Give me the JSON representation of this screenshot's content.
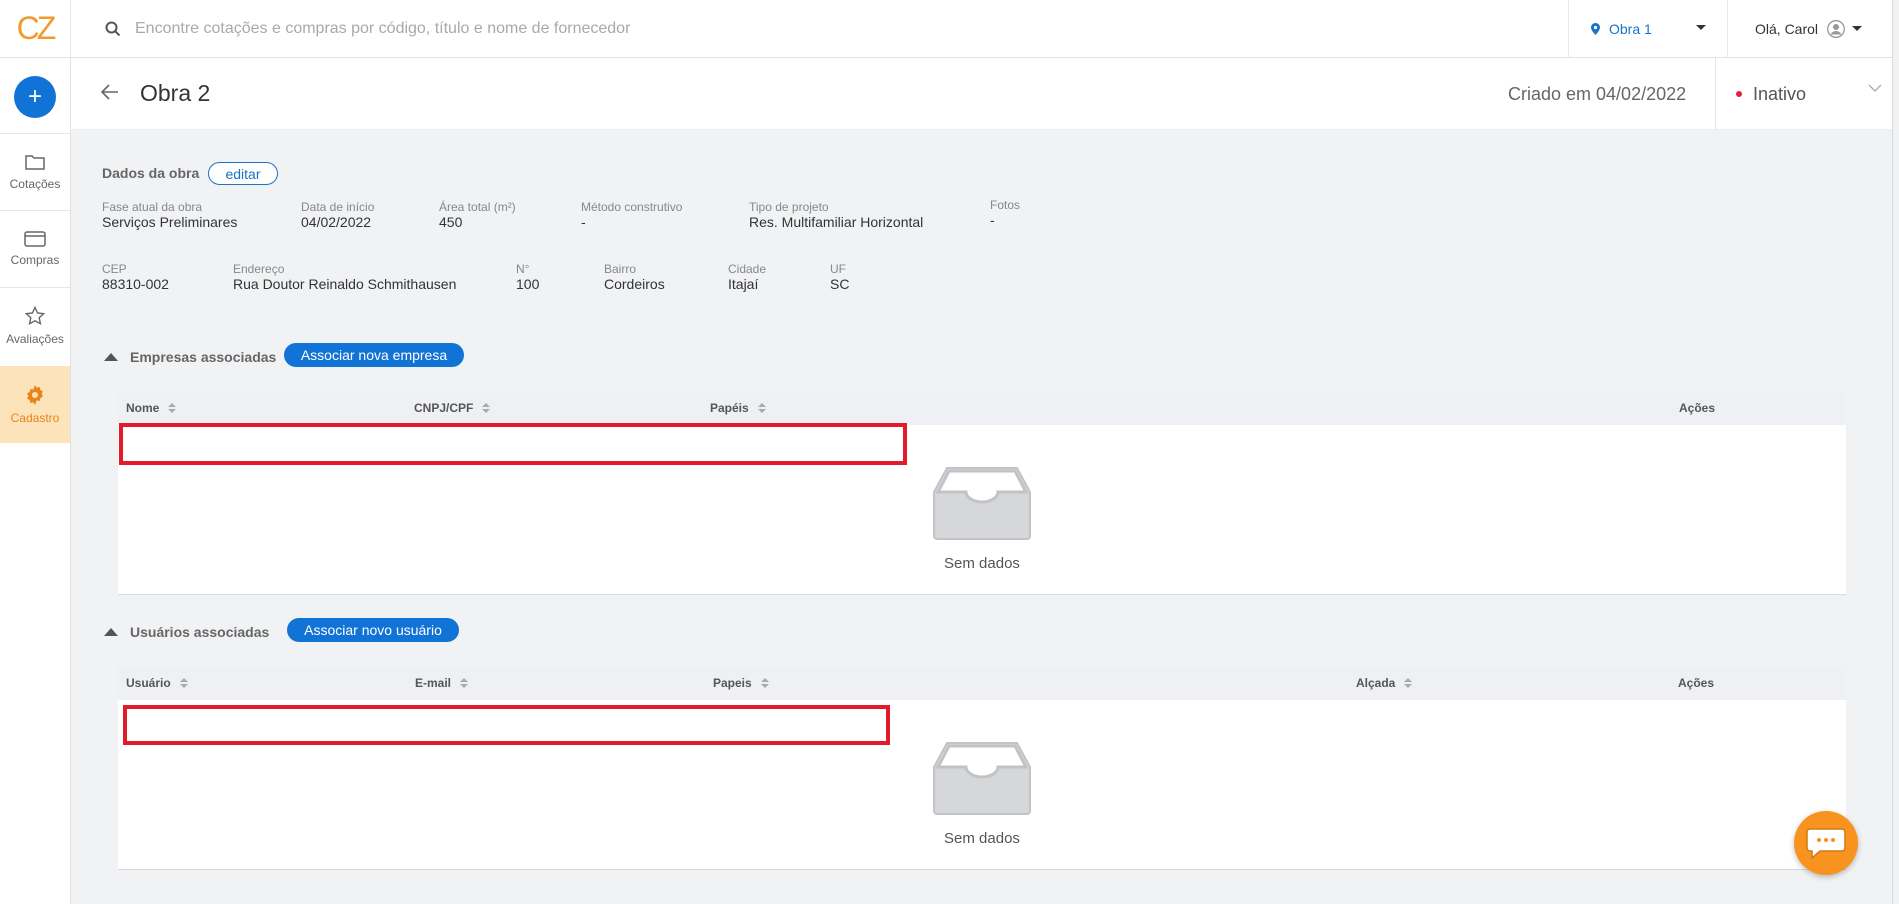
{
  "app": {
    "logo": "CZ"
  },
  "topbar": {
    "search_placeholder": "Encontre cotações e compras por código, título e nome de fornecedor",
    "obra_selected": "Obra 1",
    "greeting": "Olá, Carol"
  },
  "sidebar": {
    "add_label": "+",
    "items": [
      {
        "label": "Cotações",
        "icon": "folder-icon"
      },
      {
        "label": "Compras",
        "icon": "card-icon"
      },
      {
        "label": "Avaliações",
        "icon": "star-icon"
      },
      {
        "label": "Cadastro",
        "icon": "gear-icon",
        "active": true
      }
    ]
  },
  "header": {
    "title": "Obra 2",
    "created": "Criado em 04/02/2022",
    "status": "Inativo",
    "status_color": "#e0223a"
  },
  "dados": {
    "title": "Dados da obra",
    "edit_label": "editar",
    "row1": [
      {
        "label": "Fase atual da obra",
        "value": "Serviços Preliminares"
      },
      {
        "label": "Data de início",
        "value": "04/02/2022"
      },
      {
        "label": "Área total (m²)",
        "value": "450"
      },
      {
        "label": "Método construtivo",
        "value": "-"
      },
      {
        "label": "Tipo de projeto",
        "value": "Res. Multifamiliar Horizontal"
      },
      {
        "label": "Fotos",
        "value": "-"
      }
    ],
    "row2": [
      {
        "label": "CEP",
        "value": "88310-002"
      },
      {
        "label": "Endereço",
        "value": "Rua Doutor Reinaldo Schmithausen"
      },
      {
        "label": "N°",
        "value": "100"
      },
      {
        "label": "Bairro",
        "value": "Cordeiros"
      },
      {
        "label": "Cidade",
        "value": "Itajaí"
      },
      {
        "label": "UF",
        "value": "SC"
      }
    ]
  },
  "empresas": {
    "title": "Empresas associadas",
    "button": "Associar nova empresa",
    "columns": [
      "Nome",
      "CNPJ/CPF",
      "Papéis",
      "Ações"
    ],
    "empty": "Sem dados"
  },
  "usuarios": {
    "title": "Usuários associadas",
    "button": "Associar novo usuário",
    "columns": [
      "Usuário",
      "E-mail",
      "Papeis",
      "Alçada",
      "Ações"
    ],
    "empty": "Sem dados"
  },
  "colors": {
    "brand_orange": "#f39a2b",
    "primary_blue": "#1273d6",
    "highlight_red": "#e21b2a"
  }
}
